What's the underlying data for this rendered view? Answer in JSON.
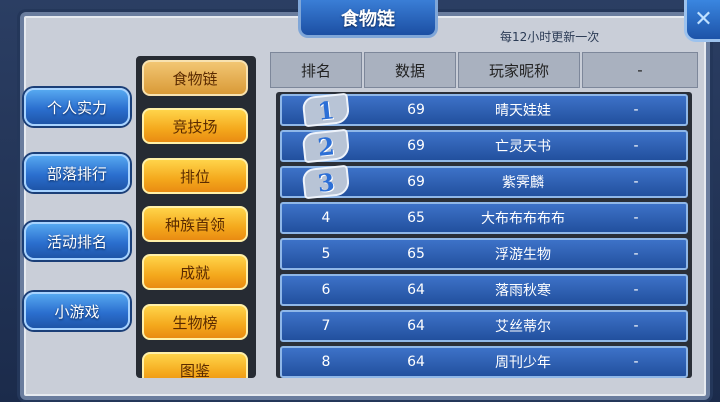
{
  "title": "食物链",
  "update_note": "每12小时更新一次",
  "close_icon": "✕",
  "categories": [
    {
      "label": "个人实力"
    },
    {
      "label": "部落排行"
    },
    {
      "label": "活动排名"
    },
    {
      "label": "小游戏"
    }
  ],
  "sub_menu": [
    {
      "label": "食物链",
      "active": true
    },
    {
      "label": "竞技场"
    },
    {
      "label": "排位"
    },
    {
      "label": "种族首领"
    },
    {
      "label": "成就"
    },
    {
      "label": "生物榜"
    },
    {
      "label": "图鉴"
    }
  ],
  "table": {
    "headers": [
      "排名",
      "数据",
      "玩家昵称",
      "-"
    ],
    "rows": [
      {
        "rank": "1",
        "data": "69",
        "name": "晴天娃娃",
        "extra": "-"
      },
      {
        "rank": "2",
        "data": "69",
        "name": "亡灵天书",
        "extra": "-"
      },
      {
        "rank": "3",
        "data": "69",
        "name": "紫霁麟",
        "extra": "-"
      },
      {
        "rank": "4",
        "data": "65",
        "name": "大布布布布布",
        "extra": "-"
      },
      {
        "rank": "5",
        "data": "65",
        "name": "浮游生物",
        "extra": "-"
      },
      {
        "rank": "6",
        "data": "64",
        "name": "落雨秋寒",
        "extra": "-"
      },
      {
        "rank": "7",
        "data": "64",
        "name": "艾丝蒂尔",
        "extra": "-"
      },
      {
        "rank": "8",
        "data": "64",
        "name": "周刊少年",
        "extra": "-"
      }
    ]
  }
}
